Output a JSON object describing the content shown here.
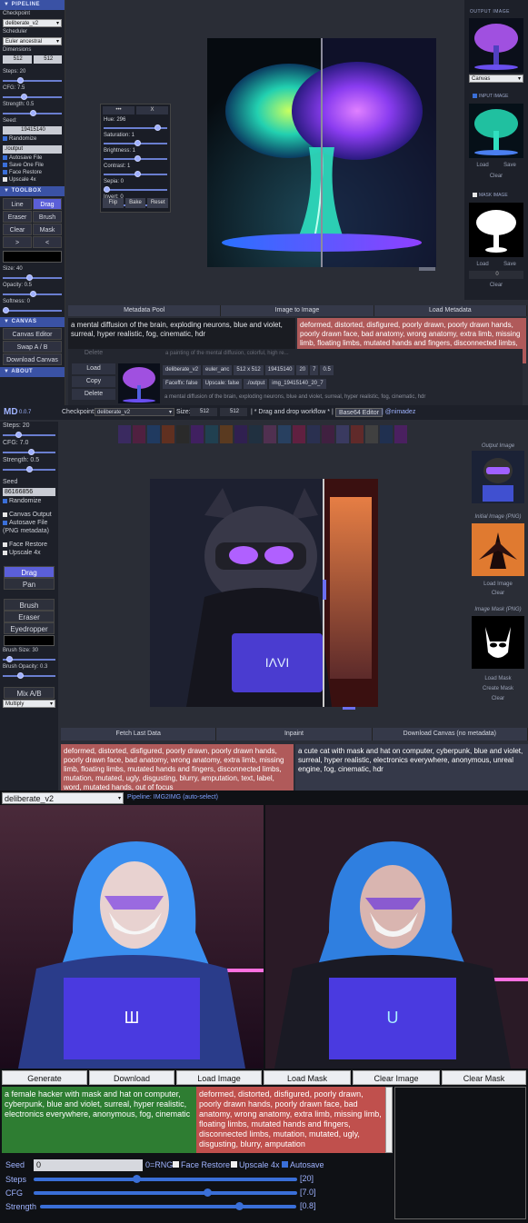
{
  "panel1": {
    "sidebar": {
      "pipeline_header": "▼ PIPELINE",
      "checkpoint_label": "Checkpoint",
      "checkpoint_value": "deliberate_v2",
      "scheduler_label": "Scheduler",
      "scheduler_value": "Euler ancestral",
      "dimensions_label": "Dimensions",
      "width": "512",
      "height": "512",
      "steps_label": "Steps: 20",
      "cfg_label": "CFG: 7.5",
      "strength_label": "Strength: 0.5",
      "seed_label": "Seed:",
      "seed_value": "19415140",
      "randomize": "Randomize",
      "output_path": "./output",
      "autosave": "Autosave File",
      "save_one": "Save One File",
      "face_restore": "Face Restore",
      "upscale": "Upscale 4x",
      "toolbox_header": "▼ TOOLBOX",
      "tools": [
        "Line",
        "Drag",
        "Eraser",
        "Brush",
        "Clear",
        "Mask",
        ">",
        "<"
      ],
      "size_label": "Size: 40",
      "opacity_label": "Opacity: 0.5",
      "softness_label": "Softness: 0",
      "canvas_header": "▼ CANVAS",
      "canvas_editor": "Canvas Editor",
      "swap": "Swap A / B",
      "download_canvas": "Download Canvas",
      "about_header": "▼ ABOUT"
    },
    "filters": {
      "btn1": "•••",
      "btn2": "X",
      "hue": "Hue: 296",
      "saturation": "Saturation: 1",
      "brightness": "Brightness: 1",
      "contrast": "Contrast: 1",
      "sepia": "Sepia: 0",
      "invert": "Invert: 0",
      "flip": "Flip",
      "bake": "Bake",
      "reset": "Reset"
    },
    "right": {
      "output_header": "OUTPUT IMAGE",
      "output_select": "Canvas",
      "input_header": "INPUT IMAGE",
      "load": "Load",
      "save": "Save",
      "clear": "Clear",
      "mask_header": "MASK IMAGE",
      "mask_value": "0"
    },
    "tabs": [
      "Metadata Pool",
      "Image to Image",
      "Load Metadata"
    ],
    "prompt": "a mental diffusion of the brain, exploding neurons, blue and violet, surreal, hyper realistic, fog, cinematic, hdr",
    "negative": "deformed, distorted, disfigured, poorly drawn, poorly drawn hands, poorly drawn face, bad anatomy, wrong anatomy, extra limb, missing limb, floating limbs, mutated hands and fingers, disconnected limbs, mutation, mutated, ugly, disgusting, blurry, amputation, malformed hands, out of focus",
    "pool": {
      "delete_faded": "Delete",
      "faded_caption": "a painting of the mental diffusion, colorful, high re...",
      "load": "Load",
      "copy": "Copy",
      "delete": "Delete",
      "tags": [
        "deliberate_v2",
        "euler_anc",
        "512 x 512",
        "19415140",
        "20",
        "7",
        "0.5"
      ],
      "tags2": [
        "Faceffx: false",
        "Upscale: false",
        "./output",
        "img_19415140_20_7"
      ],
      "caption": "a mental diffusion of the brain, exploding neurons, blue and violet, surreal, hyper realistic, fog, cinematic, hdr"
    }
  },
  "panel2": {
    "logo": "MD",
    "version": "0.0.7",
    "checkpoint_label": "Checkpoint:",
    "checkpoint_value": "deliberate_v2",
    "size_label": "Size:",
    "w": "512",
    "h": "512",
    "drag_hint": "| * Drag and drop workflow * |",
    "base64": "Base64 Editor",
    "user": "| @nimadez",
    "sidebar": {
      "steps": "Steps: 20",
      "cfg": "CFG: 7.0",
      "strength": "Strength: 0.5",
      "seed_label": "Seed",
      "seed_value": "86166856",
      "randomize": "Randomize",
      "canvas_output": "Canvas Output",
      "autosave": "Autosave File",
      "png_meta": "(PNG metadata)",
      "face_restore": "Face Restore",
      "upscale": "Upscale 4x",
      "drag": "Drag",
      "pan": "Pan",
      "brush": "Brush",
      "eraser": "Eraser",
      "eyedropper": "Eyedropper",
      "brush_size": "Brush Size: 30",
      "brush_opacity": "Brush Opacity: 0.3",
      "mix": "Mix A/B",
      "blend": "Multiply"
    },
    "right": {
      "output": "Output Image",
      "initial": "Initial Image (PNG)",
      "load_image": "Load Image",
      "clear": "Clear",
      "mask": "Image Mask (PNG)",
      "load_mask": "Load Mask",
      "create_mask": "Create Mask",
      "clear2": "Clear"
    },
    "tabs": [
      "Fetch Last Data",
      "Inpaint",
      "Download Canvas (no metadata)"
    ],
    "negative": "deformed, distorted, disfigured, poorly drawn, poorly drawn hands, poorly drawn face, bad anatomy, wrong anatomy, extra limb, missing limb, floating limbs, mutated hands and fingers, disconnected limbs, mutation, mutated, ugly, disgusting, blurry, amputation, text, label, word, mutated hands, out of focus",
    "prompt": "a cute cat with mask and hat on computer, cyberpunk, blue and violet, surreal, hyper realistic, electronics everywhere, anonymous, unreal engine, fog, cinematic, hdr"
  },
  "panel3": {
    "model": "deliberate_v2",
    "pipeline": "Pipeline: IMG2IMG (auto-select)",
    "buttons": [
      "Generate",
      "Download",
      "Load Image",
      "Load Mask",
      "Clear Image",
      "Clear Mask"
    ],
    "prompt": "a female hacker with mask and hat on computer, cyberpunk, blue and violet, surreal, hyper realistic, electronics everywhere, anonymous, fog, cinematic",
    "negative": "deformed, distorted, disfigured, poorly drawn, poorly drawn hands, poorly drawn face, bad anatomy, wrong anatomy, extra limb, missing limb, floating limbs, mutated hands and fingers, disconnected limbs, mutation, mutated, ugly, disgusting, blurry, amputation",
    "seed_label": "Seed",
    "seed_value": "0",
    "rng": "0=RNG",
    "face_restore": "Face Restore",
    "upscale": "Upscale 4x",
    "autosave": "Autosave",
    "steps_label": "Steps",
    "steps_value": "[20]",
    "cfg_label": "CFG",
    "cfg_value": "[7.0]",
    "strength_label": "Strength",
    "strength_value": "[0.8]"
  }
}
